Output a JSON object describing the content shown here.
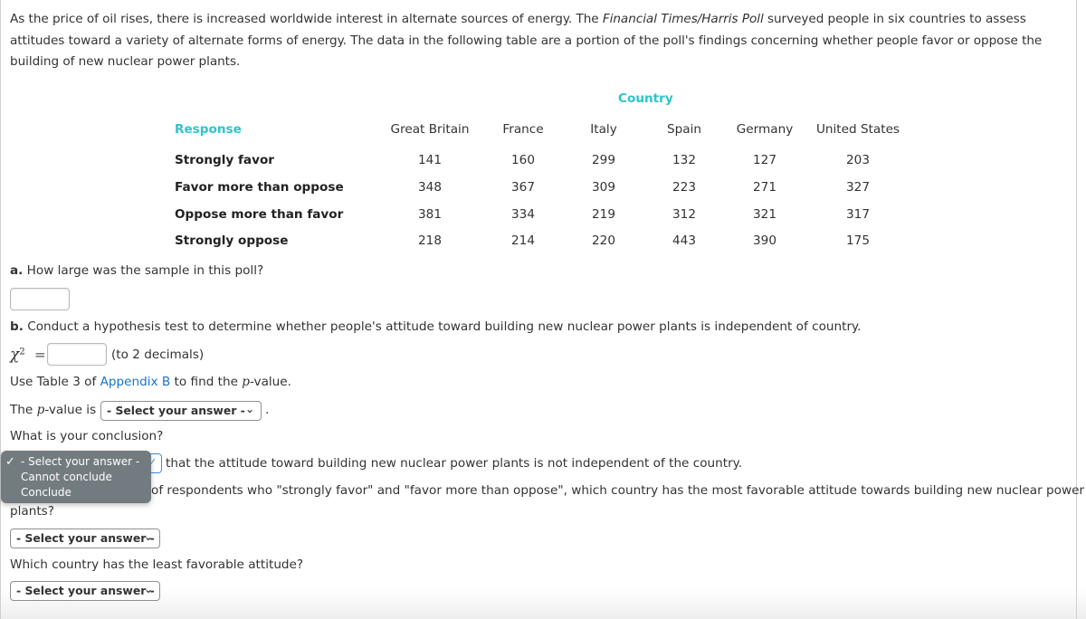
{
  "intro": {
    "part1": "As the price of oil rises, there is increased worldwide interest in alternate sources of energy. The ",
    "source": "Financial Times/Harris Poll",
    "part2": " surveyed people in six countries to assess attitudes toward a variety of alternate forms of energy. The data in the following table are a portion of the poll's findings concerning whether people favor or oppose the building of new nuclear power plants."
  },
  "table": {
    "group_header": "Country",
    "row_header": "Response",
    "columns": [
      "Great Britain",
      "France",
      "Italy",
      "Spain",
      "Germany",
      "United States"
    ],
    "rows": [
      {
        "label": "Strongly favor",
        "values": [
          "141",
          "160",
          "299",
          "132",
          "127",
          "203"
        ]
      },
      {
        "label": "Favor more than oppose",
        "values": [
          "348",
          "367",
          "309",
          "223",
          "271",
          "327"
        ]
      },
      {
        "label": "Oppose more than favor",
        "values": [
          "381",
          "334",
          "219",
          "312",
          "321",
          "317"
        ]
      },
      {
        "label": "Strongly oppose",
        "values": [
          "218",
          "214",
          "220",
          "443",
          "390",
          "175"
        ]
      }
    ]
  },
  "part_a": {
    "letter": "a.",
    "question": " How large was the sample in this poll?",
    "answer_value": ""
  },
  "part_b": {
    "letter": "b.",
    "question": " Conduct a hypothesis test to determine whether people's attitude toward building new nuclear power plants is independent of country.",
    "chi_label": "χ",
    "chi_sup": "2",
    "equals": "=",
    "chi_value": "",
    "chi_hint": "(to 2 decimals)",
    "use_table_prefix": "Use Table 3 of ",
    "appendix_link": "Appendix B",
    "use_table_suffix_1": " to find the ",
    "p_symbol": "p",
    "use_table_suffix_2": "-value.",
    "pvalue_prefix": "The ",
    "pvalue_suffix": "-value is",
    "pvalue_select": "- Select your answer -",
    "period": ".",
    "conclusion_question": "What is your conclusion?",
    "conclusion_rest": "that the attitude toward building new nuclear power plants is not independent of the country.",
    "conclusion_dropdown": {
      "options": [
        "- Select your answer -",
        "Cannot conclude",
        "Conclude"
      ],
      "selected": "- Select your answer -"
    }
  },
  "part_c": {
    "question_visible": "of respondents who \"strongly favor\" and \"favor more than oppose\", which country has the most favorable attitude towards building new nuclear power",
    "question_wrap": "plants?",
    "most_select": "- Select your answer -",
    "least_question": "Which country has the least favorable attitude?",
    "least_select": "- Select your answer -"
  },
  "icons": {
    "chevron": "⌄",
    "check": "✓"
  }
}
